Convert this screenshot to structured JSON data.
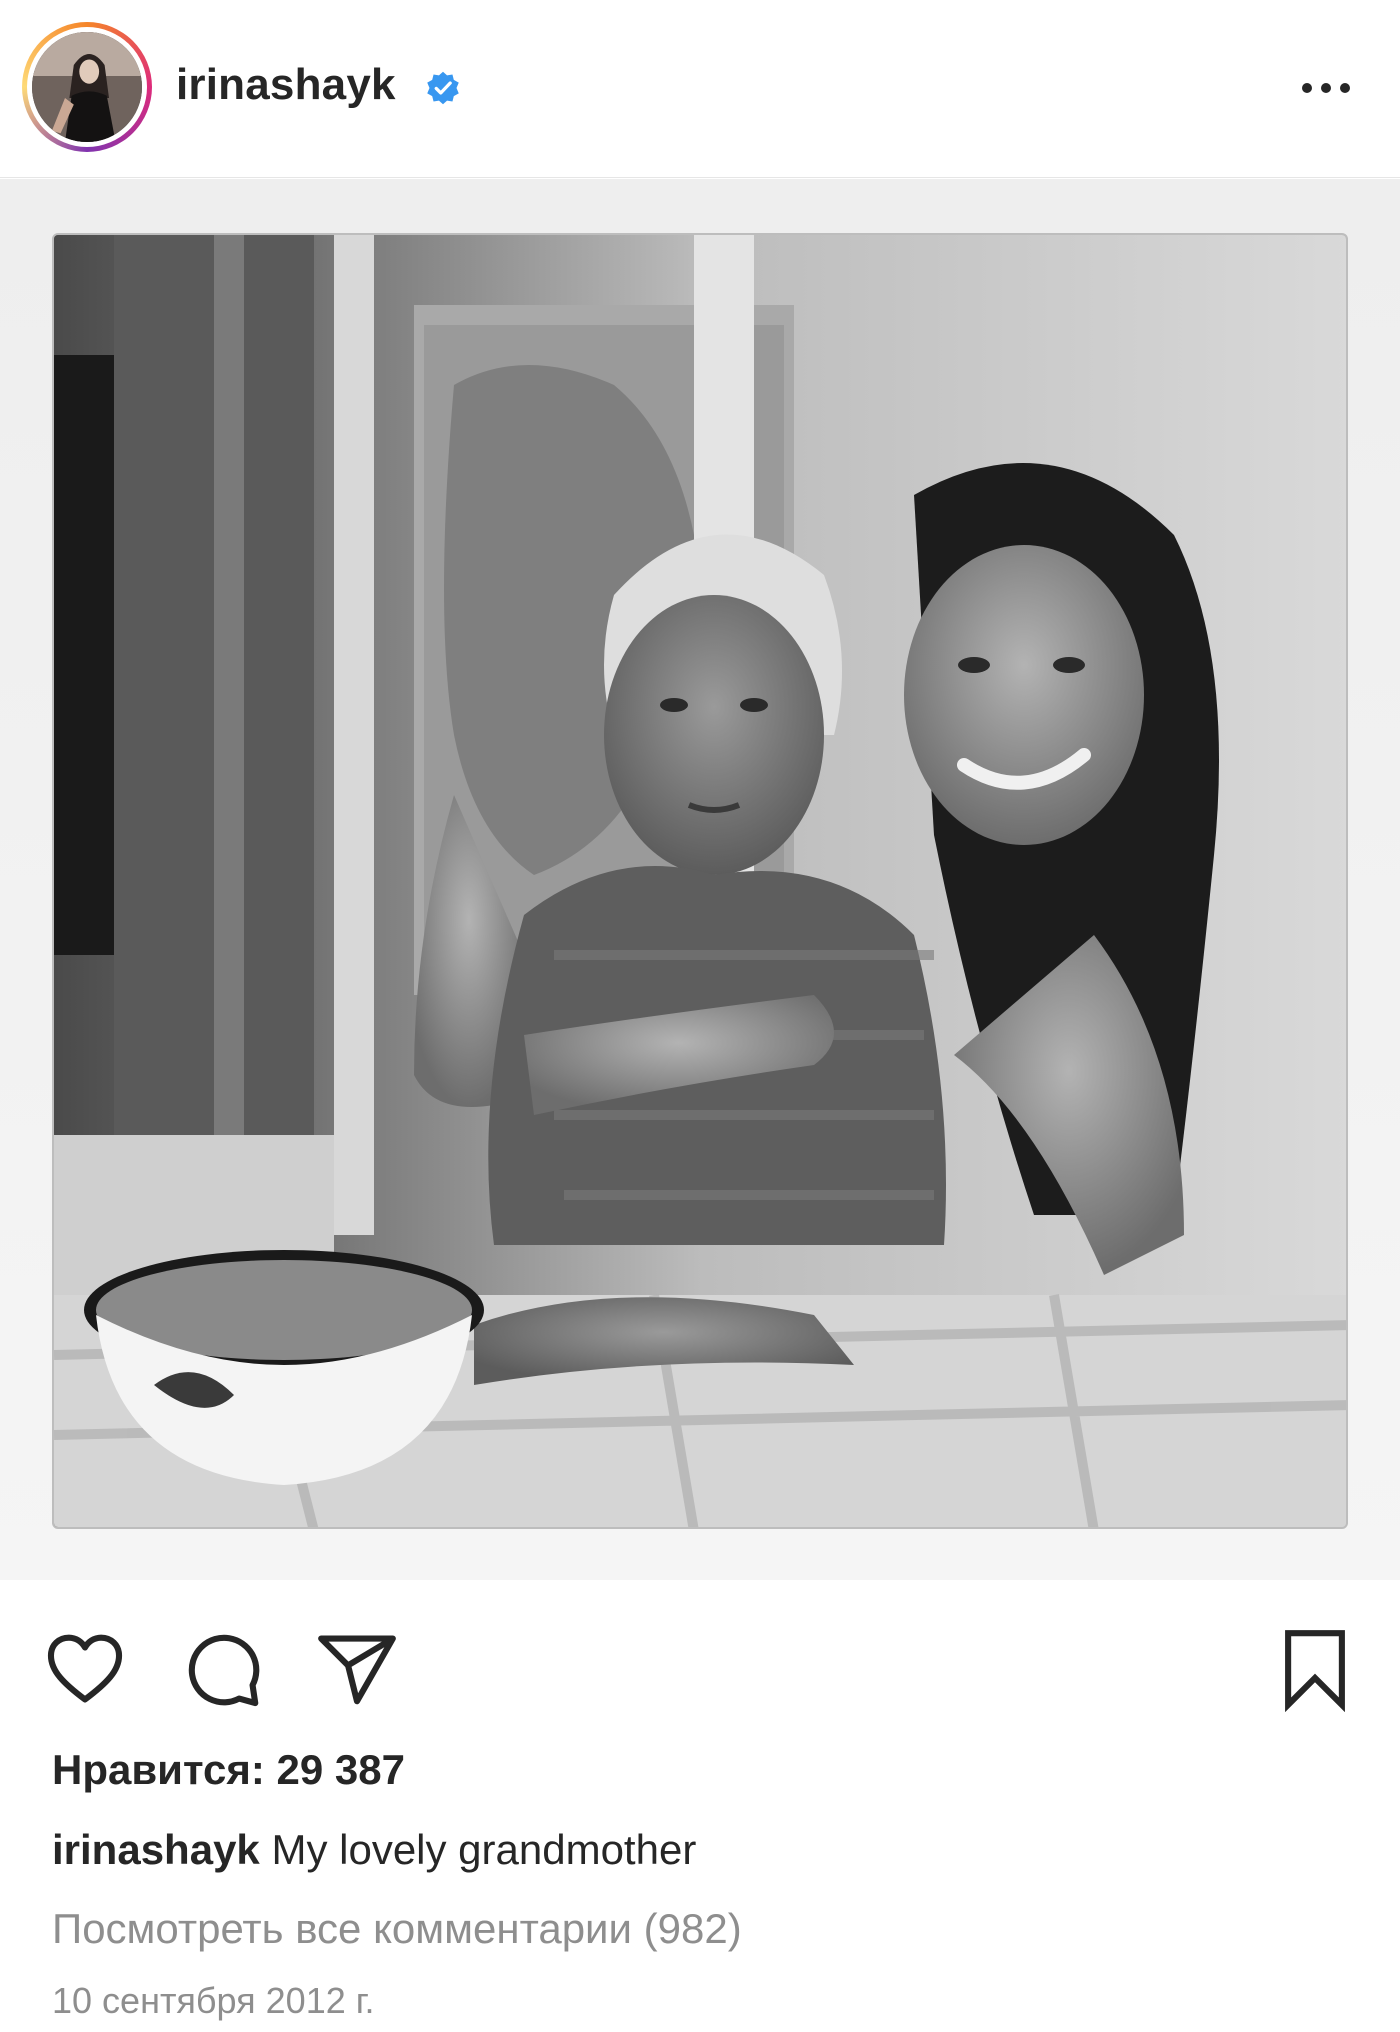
{
  "header": {
    "username": "irinashayk",
    "verified_color": "#3897f0"
  },
  "post": {
    "image_tone": "black-and-white"
  },
  "actions": {
    "icons": [
      "heart-icon",
      "comment-icon",
      "share-icon",
      "bookmark-icon"
    ]
  },
  "meta": {
    "likes": "Нравится: 29 387",
    "caption_user": "irinashayk",
    "caption_text": "My lovely grandmother",
    "view_comments": "Посмотреть все комментарии (982)",
    "date": "10 сентября 2012 г."
  }
}
